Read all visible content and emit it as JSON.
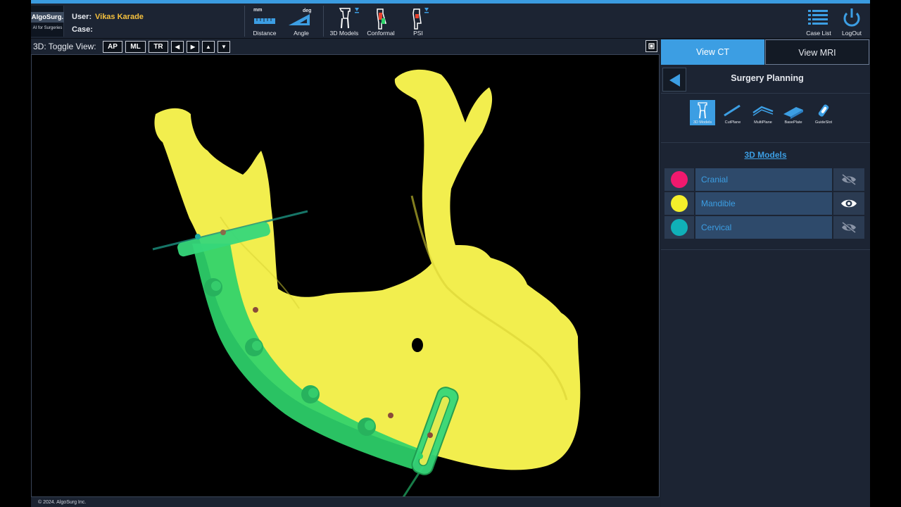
{
  "header": {
    "logo_text": "AlgoSurg.",
    "logo_tagline": "AI for Surgeries",
    "user_label": "User:",
    "user_name": "Vikas Karade",
    "case_label": "Case:",
    "case_value": "",
    "tools": {
      "distance": {
        "unit": "mm",
        "label": "Distance",
        "icon": "ruler-icon"
      },
      "angle": {
        "unit": "deg",
        "label": "Angle",
        "icon": "set-square-icon"
      },
      "models3d": {
        "label": "3D Models",
        "icon": "bones-icon"
      },
      "conformal": {
        "label": "Conformal",
        "icon": "conformal-icon"
      },
      "psi": {
        "label": "PSI",
        "icon": "psi-icon"
      }
    },
    "case_list_label": "Case List",
    "logout_label": "LogOut"
  },
  "viewer": {
    "title": "3D:  Toggle View:",
    "buttons": [
      "AP",
      "ML",
      "TR"
    ],
    "arrows": [
      "◀",
      "▶",
      "▲",
      "▼"
    ],
    "copyright": "© 2024. AlgoSurg Inc."
  },
  "panel": {
    "tabs": [
      "View CT",
      "View MRI"
    ],
    "title": "Surgery Planning",
    "tools": [
      "3D Models",
      "CutPlane",
      "MultiPlane",
      "BasePlate",
      "GuideSlot"
    ],
    "section_title": "3D Models",
    "models": [
      {
        "name": "Cranial",
        "color": "#f0196e",
        "visible": false
      },
      {
        "name": "Mandible",
        "color": "#f4ef2b",
        "visible": true
      },
      {
        "name": "Cervical",
        "color": "#10b0b8",
        "visible": false
      }
    ]
  },
  "colors": {
    "accent": "#3c9ee3",
    "bone": "#f2ee4e",
    "guide": "#2ed36b"
  }
}
